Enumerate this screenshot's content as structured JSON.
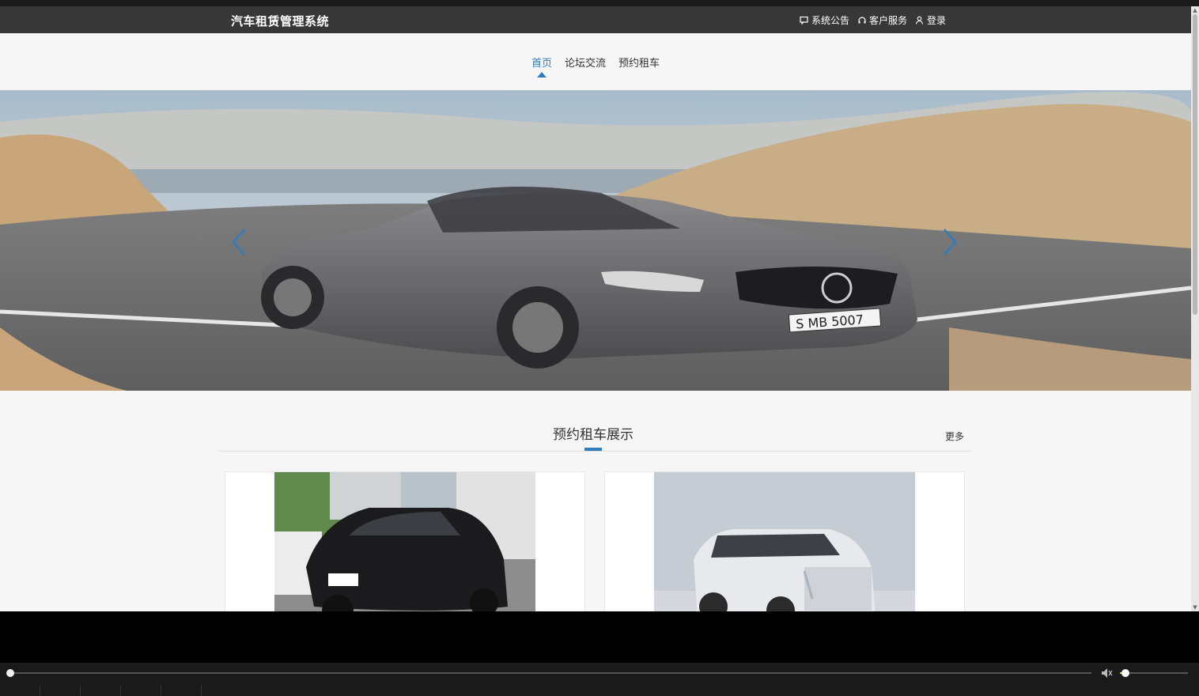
{
  "header": {
    "title": "汽车租赁管理系统",
    "links": [
      {
        "label": "系统公告",
        "icon": "notice-icon"
      },
      {
        "label": "客户服务",
        "icon": "headset-icon"
      },
      {
        "label": "登录",
        "icon": "user-icon"
      }
    ]
  },
  "nav": {
    "items": [
      {
        "label": "首页",
        "active": true
      },
      {
        "label": "论坛交流",
        "active": false
      },
      {
        "label": "预约租车",
        "active": false
      }
    ]
  },
  "banner": {
    "plate": "S MB 5007"
  },
  "section": {
    "title": "预约租车展示",
    "more": "更多"
  },
  "colors": {
    "accent": "#2f7dbd",
    "header_bg": "#373737"
  },
  "player": {
    "progress": 0.0,
    "volume": 0.05
  }
}
